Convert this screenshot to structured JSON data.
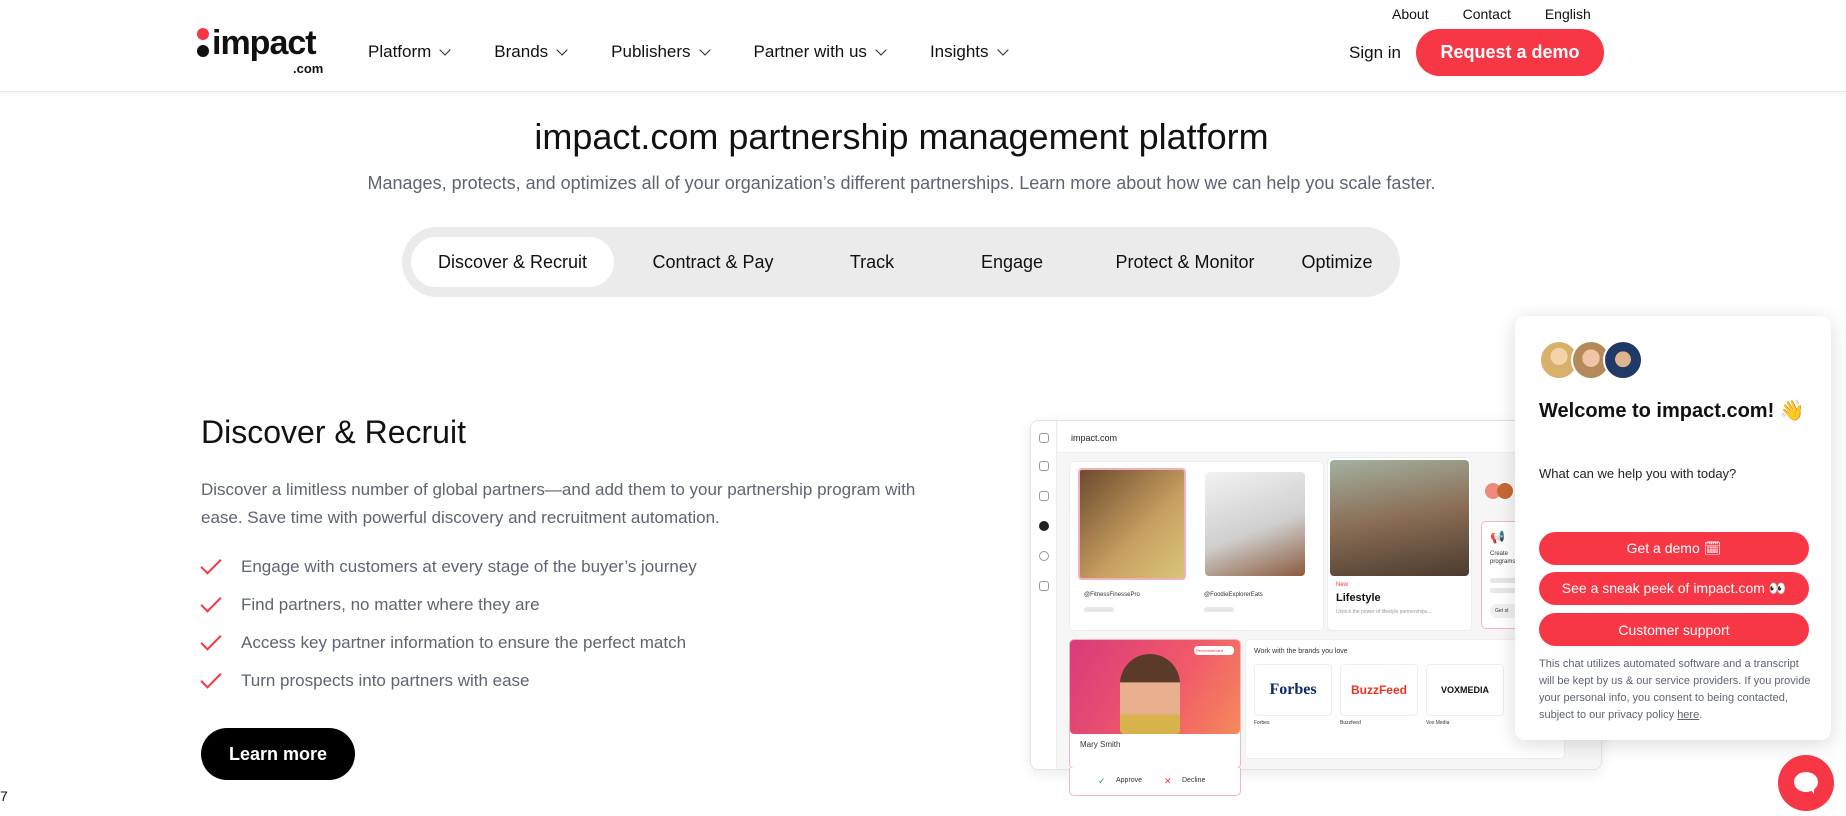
{
  "header": {
    "logo": {
      "word": "impact",
      "sub": ".com"
    },
    "nav": [
      {
        "label": "Platform"
      },
      {
        "label": "Brands"
      },
      {
        "label": "Publishers"
      },
      {
        "label": "Partner with us"
      },
      {
        "label": "Insights"
      }
    ],
    "top_links": [
      "About",
      "Contact",
      "English"
    ],
    "sign_in": "Sign in",
    "demo_button": "Request a demo"
  },
  "hero": {
    "title": "impact.com partnership management platform",
    "subtitle": "Manages, protects, and optimizes all of your organization’s different partnerships. Learn more about how we can help you scale faster."
  },
  "tabs": [
    {
      "label": "Discover & Recruit",
      "active": true
    },
    {
      "label": "Contract & Pay",
      "active": false
    },
    {
      "label": "Track",
      "active": false
    },
    {
      "label": "Engage",
      "active": false
    },
    {
      "label": "Protect & Monitor",
      "active": false
    },
    {
      "label": "Optimize",
      "active": false
    }
  ],
  "section": {
    "title": "Discover & Recruit",
    "description": "Discover a limitless number of global partners—and add them to your partnership program with ease. Save time with powerful discovery and recruitment automation.",
    "bullets": [
      "Engage with customers at every stage of the buyer’s journey",
      "Find partners, no matter where they are",
      "Access key partner information to ensure the perfect match",
      "Turn prospects into partners with ease"
    ],
    "learn_more": "Learn more"
  },
  "mockup": {
    "brand": "impact.com",
    "handles": [
      "@FitnessFinessePro",
      "@FoodieExplorerEats"
    ],
    "lifestyle_tag": "New",
    "lifestyle_title": "Lifestyle",
    "lifestyle_desc": "Unlock the power of lifestyle partnerships...",
    "create_text": "Create programs",
    "get_started": "Get st",
    "recommended_tag": "Recommended",
    "person_name": "Mary Smith",
    "approve": "Approve",
    "decline": "Decline",
    "brands_heading": "Work with the brands you love",
    "brands": [
      {
        "logo": "Forbes",
        "name": "Forbes"
      },
      {
        "logo": "BuzzFeed",
        "name": "Buzzfeed"
      },
      {
        "logo": "VOXMEDIA",
        "name": "Vox Media"
      }
    ]
  },
  "chat": {
    "title": "Welcome to impact.com! 👋",
    "subtitle": "What can we help you with today?",
    "buttons": [
      "Get a demo 🗓",
      "See a sneak peek of impact.com 👀",
      "Customer support"
    ],
    "footer": "This chat utilizes automated software and a transcript will be kept by us & our service providers. If you provide your personal info, you consent to being contacted, subject to our privacy policy",
    "footer_link": "here",
    "footer_end": "."
  },
  "stray_text": "7",
  "colors": {
    "brand_red": "#f73646",
    "text_gray": "#5d6472"
  }
}
